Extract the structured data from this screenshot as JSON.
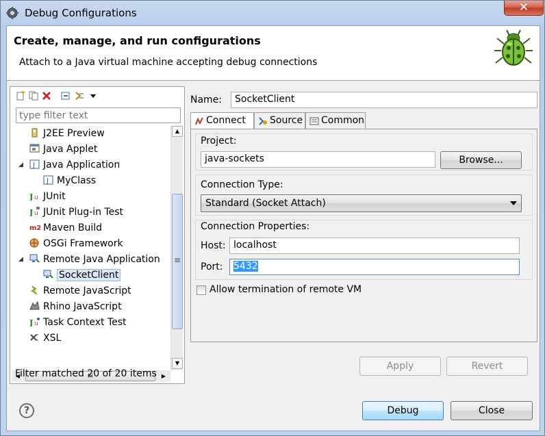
{
  "window": {
    "title": "Debug Configurations",
    "close_glyph": "✕"
  },
  "header": {
    "title": "Create, manage, and run configurations",
    "description": "Attach to a Java virtual machine accepting debug connections"
  },
  "left": {
    "filter_placeholder": "type filter text",
    "tree": [
      {
        "label": "J2EE Preview",
        "icon": "j2ee-preview-icon"
      },
      {
        "label": "Java Applet",
        "icon": "java-applet-icon"
      },
      {
        "label": "Java Application",
        "icon": "java-application-icon",
        "expanded": true
      },
      {
        "label": "MyClass",
        "icon": "java-class-icon",
        "child": true
      },
      {
        "label": "JUnit",
        "icon": "junit-icon"
      },
      {
        "label": "JUnit Plug-in Test",
        "icon": "junit-plugin-icon"
      },
      {
        "label": "Maven Build",
        "icon": "maven-icon"
      },
      {
        "label": "OSGi Framework",
        "icon": "osgi-icon"
      },
      {
        "label": "Remote Java Application",
        "icon": "remote-java-icon",
        "expanded": true
      },
      {
        "label": "SocketClient",
        "icon": "remote-java-config-icon",
        "child": true,
        "selected": true
      },
      {
        "label": "Remote JavaScript",
        "icon": "remote-javascript-icon"
      },
      {
        "label": "Rhino JavaScript",
        "icon": "rhino-icon"
      },
      {
        "label": "Task Context Test",
        "icon": "task-context-icon"
      },
      {
        "label": "XSL",
        "icon": "xsl-icon"
      }
    ],
    "status": "Filter matched 20 of 20 items",
    "scroll_glyphs": {
      "up": "▲",
      "down": "▼",
      "left": "◀",
      "right": "▶",
      "grip_v": "≡",
      "grip_h": "III"
    }
  },
  "right": {
    "name_label": "Name:",
    "name_value": "SocketClient",
    "tabs": [
      {
        "label": "Connect",
        "icon": "connect-icon",
        "active": true
      },
      {
        "label": "Source",
        "icon": "source-icon"
      },
      {
        "label": "Common",
        "icon": "common-icon"
      }
    ],
    "project": {
      "label": "Project:",
      "value": "java-sockets",
      "browse_label": "Browse..."
    },
    "connection_type": {
      "label": "Connection Type:",
      "value": "Standard (Socket Attach)"
    },
    "connection_props": {
      "label": "Connection Properties:",
      "host_label": "Host:",
      "host_value": "localhost",
      "port_label": "Port:",
      "port_value": "5432"
    },
    "allow_termination_label": "Allow termination of remote VM",
    "allow_termination_checked": false,
    "apply_label": "Apply",
    "revert_label": "Revert"
  },
  "footer": {
    "help_glyph": "?",
    "debug_label": "Debug",
    "close_label": "Close"
  },
  "colors": {
    "selection": "#3399ff",
    "tree_selected_bg": "#dbe7f5",
    "window_frame": "#bfd3ec"
  }
}
